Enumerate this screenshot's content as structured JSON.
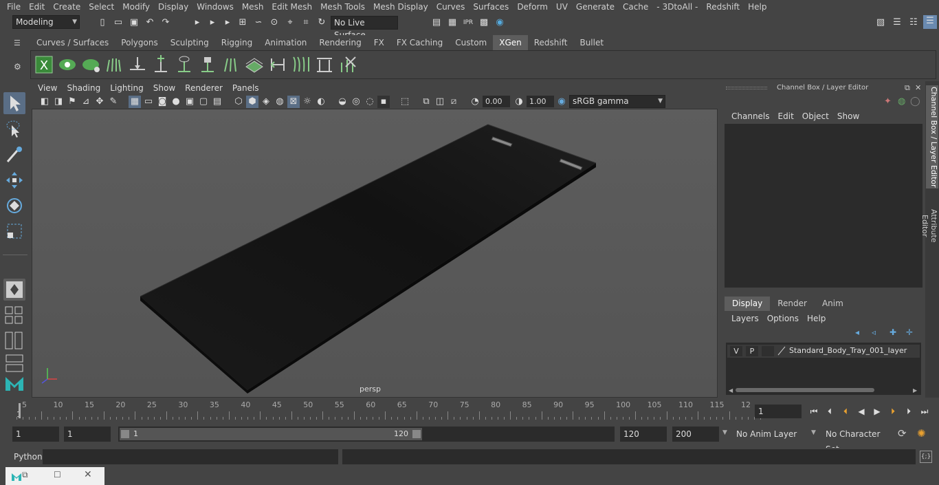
{
  "menubar": {
    "items": [
      "File",
      "Edit",
      "Create",
      "Select",
      "Modify",
      "Display",
      "Windows",
      "Mesh",
      "Edit Mesh",
      "Mesh Tools",
      "Mesh Display",
      "Curves",
      "Surfaces",
      "Deform",
      "UV",
      "Generate",
      "Cache",
      "- 3DtoAll -",
      "Redshift",
      "Help"
    ]
  },
  "statusline": {
    "mode": "Modeling",
    "live_surface": "No Live Surface"
  },
  "shelf": {
    "tabs": [
      "Curves / Surfaces",
      "Polygons",
      "Sculpting",
      "Rigging",
      "Animation",
      "Rendering",
      "FX",
      "FX Caching",
      "Custom",
      "XGen",
      "Redshift",
      "Bullet"
    ],
    "active_tab": "XGen"
  },
  "viewport": {
    "menu": [
      "View",
      "Shading",
      "Lighting",
      "Show",
      "Renderer",
      "Panels"
    ],
    "exposure": "0.00",
    "gamma": "1.00",
    "colorspace": "sRGB gamma",
    "camera_label": "persp"
  },
  "right_panel": {
    "title": "Channel Box / Layer Editor",
    "menu": [
      "Channels",
      "Edit",
      "Object",
      "Show"
    ],
    "layer_tabs": [
      "Display",
      "Render",
      "Anim"
    ],
    "active_layer_tab": "Display",
    "layer_menu": [
      "Layers",
      "Options",
      "Help"
    ],
    "layer": {
      "v": "V",
      "p": "P",
      "name": "Standard_Body_Tray_001_layer"
    },
    "side_tabs": [
      "Channel Box / Layer Editor",
      "Attribute Editor"
    ]
  },
  "timeslider": {
    "ticks": [
      "5",
      "10",
      "15",
      "20",
      "25",
      "30",
      "35",
      "40",
      "45",
      "50",
      "55",
      "60",
      "65",
      "70",
      "75",
      "80",
      "85",
      "90",
      "95",
      "100",
      "105",
      "110",
      "115",
      "12"
    ],
    "start_marker": "1",
    "current_frame": "1"
  },
  "range": {
    "start": "1",
    "playback_start": "1",
    "slider_start": "1",
    "slider_end": "120",
    "playback_end": "120",
    "end": "200",
    "anim_layer": "No Anim Layer",
    "character_set": "No Character Set"
  },
  "cmdline": {
    "label": "Python"
  }
}
